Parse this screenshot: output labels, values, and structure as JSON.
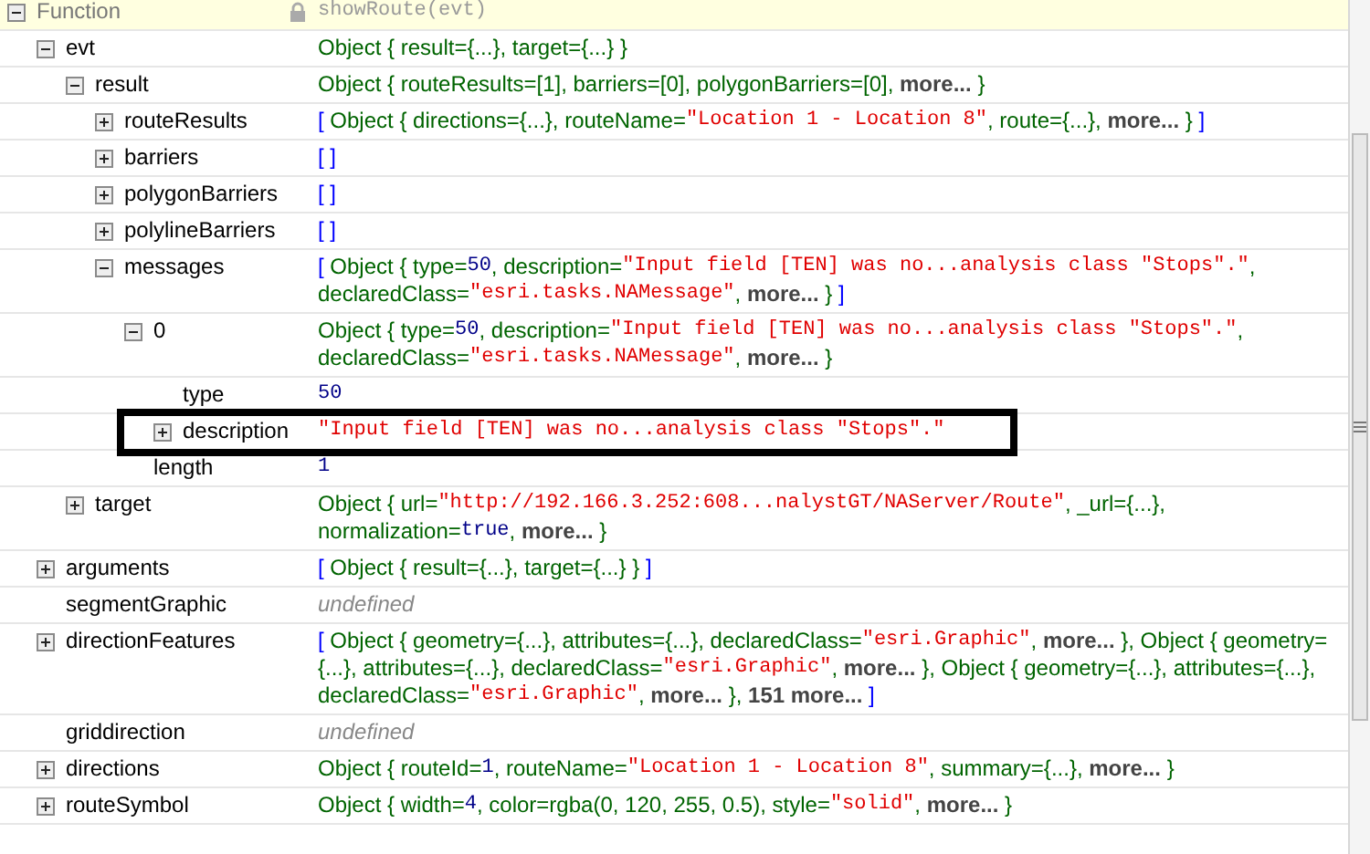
{
  "function": {
    "name": "Function",
    "expanded": true,
    "value": [
      {
        "kind": "code",
        "text": "showRoute(evt)"
      }
    ],
    "children": [
      {
        "name": "evt",
        "expanded": true,
        "value": [
          {
            "kind": "object",
            "text": "Object { result={...}, target={...} }"
          }
        ],
        "children": [
          {
            "name": "result",
            "expanded": true,
            "value": [
              {
                "kind": "object",
                "text": "Object { routeResults=[1], barriers=[0], polygonBarriers=[0], "
              },
              {
                "kind": "more",
                "text": "more..."
              },
              {
                "kind": "object",
                "text": " }"
              }
            ],
            "children": [
              {
                "name": "routeResults",
                "expanded": false,
                "value": [
                  {
                    "kind": "bracket",
                    "text": "[ "
                  },
                  {
                    "kind": "object",
                    "text": "Object { directions={...}, routeName="
                  },
                  {
                    "kind": "string",
                    "text": "\"Location 1 - Location 8\""
                  },
                  {
                    "kind": "object",
                    "text": ", route={...}, "
                  },
                  {
                    "kind": "more",
                    "text": "more..."
                  },
                  {
                    "kind": "object",
                    "text": " }"
                  },
                  {
                    "kind": "bracket",
                    "text": " ]"
                  }
                ]
              },
              {
                "name": "barriers",
                "expanded": false,
                "value": [
                  {
                    "kind": "bracket",
                    "text": "[ ]"
                  }
                ]
              },
              {
                "name": "polygonBarriers",
                "expanded": false,
                "value": [
                  {
                    "kind": "bracket",
                    "text": "[ ]"
                  }
                ]
              },
              {
                "name": "polylineBarriers",
                "expanded": false,
                "value": [
                  {
                    "kind": "bracket",
                    "text": "[ ]"
                  }
                ]
              },
              {
                "name": "messages",
                "expanded": true,
                "value": [
                  {
                    "kind": "bracket",
                    "text": "[ "
                  },
                  {
                    "kind": "object",
                    "text": "Object { type="
                  },
                  {
                    "kind": "number",
                    "text": "50"
                  },
                  {
                    "kind": "object",
                    "text": ", description="
                  },
                  {
                    "kind": "string",
                    "text": "\"Input field [TEN] was no...analysis class \"Stops\".\""
                  },
                  {
                    "kind": "object",
                    "text": ", declaredClass="
                  },
                  {
                    "kind": "string",
                    "text": "\"esri.tasks.NAMessage\""
                  },
                  {
                    "kind": "object",
                    "text": ", "
                  },
                  {
                    "kind": "more",
                    "text": "more..."
                  },
                  {
                    "kind": "object",
                    "text": " }"
                  },
                  {
                    "kind": "bracket",
                    "text": " ]"
                  }
                ],
                "children": [
                  {
                    "name": "0",
                    "expanded": true,
                    "value": [
                      {
                        "kind": "object",
                        "text": "Object { type="
                      },
                      {
                        "kind": "number",
                        "text": "50"
                      },
                      {
                        "kind": "object",
                        "text": ", description="
                      },
                      {
                        "kind": "string",
                        "text": "\"Input field [TEN] was no...analysis class \"Stops\".\""
                      },
                      {
                        "kind": "object",
                        "text": ", declaredClass="
                      },
                      {
                        "kind": "string",
                        "text": "\"esri.tasks.NAMessage\""
                      },
                      {
                        "kind": "object",
                        "text": ", "
                      },
                      {
                        "kind": "more",
                        "text": "more..."
                      },
                      {
                        "kind": "object",
                        "text": " }"
                      }
                    ],
                    "children": [
                      {
                        "name": "type",
                        "value": [
                          {
                            "kind": "number",
                            "text": "50"
                          }
                        ]
                      },
                      {
                        "name": "description",
                        "expanded": false,
                        "highlighted": true,
                        "value": [
                          {
                            "kind": "string",
                            "text": "\"Input field [TEN] was no...analysis class \"Stops\".\""
                          }
                        ]
                      }
                    ]
                  },
                  {
                    "name": "length",
                    "value": [
                      {
                        "kind": "number",
                        "text": "1"
                      }
                    ]
                  }
                ]
              }
            ]
          },
          {
            "name": "target",
            "expanded": false,
            "value": [
              {
                "kind": "object",
                "text": "Object { url="
              },
              {
                "kind": "string",
                "text": "\"http://192.166.3.252:608...nalystGT/NAServer/Route\""
              },
              {
                "kind": "object",
                "text": ", _url={...}, normalization="
              },
              {
                "kind": "number",
                "text": "true"
              },
              {
                "kind": "object",
                "text": ", "
              },
              {
                "kind": "more",
                "text": "more..."
              },
              {
                "kind": "object",
                "text": " }"
              }
            ]
          }
        ]
      },
      {
        "name": "arguments",
        "expanded": false,
        "value": [
          {
            "kind": "bracket",
            "text": "[ "
          },
          {
            "kind": "object",
            "text": "Object { result={...}, target={...} }"
          },
          {
            "kind": "bracket",
            "text": " ]"
          }
        ]
      },
      {
        "name": "segmentGraphic",
        "value": [
          {
            "kind": "undefined",
            "text": "undefined"
          }
        ]
      },
      {
        "name": "directionFeatures",
        "expanded": false,
        "value": [
          {
            "kind": "bracket",
            "text": "[ "
          },
          {
            "kind": "object",
            "text": "Object { geometry={...}, attributes={...}, declaredClass="
          },
          {
            "kind": "string",
            "text": "\"esri.Graphic\""
          },
          {
            "kind": "object",
            "text": ", "
          },
          {
            "kind": "more",
            "text": "more..."
          },
          {
            "kind": "object",
            "text": " }, Object { geometry={...}, attributes={...}, declaredClass="
          },
          {
            "kind": "string",
            "text": "\"esri.Graphic\""
          },
          {
            "kind": "object",
            "text": ", "
          },
          {
            "kind": "more",
            "text": "more..."
          },
          {
            "kind": "object",
            "text": " }, Object { geometry={...}, attributes={...}, declaredClass="
          },
          {
            "kind": "string",
            "text": "\"esri.Graphic\""
          },
          {
            "kind": "object",
            "text": ", "
          },
          {
            "kind": "more",
            "text": "more..."
          },
          {
            "kind": "object",
            "text": " }, "
          },
          {
            "kind": "more",
            "text": "151 more..."
          },
          {
            "kind": "bracket",
            "text": " ]"
          }
        ]
      },
      {
        "name": "griddirection",
        "value": [
          {
            "kind": "undefined",
            "text": "undefined"
          }
        ]
      },
      {
        "name": "directions",
        "expanded": false,
        "value": [
          {
            "kind": "object",
            "text": "Object { routeId="
          },
          {
            "kind": "number",
            "text": "1"
          },
          {
            "kind": "object",
            "text": ", routeName="
          },
          {
            "kind": "string",
            "text": "\"Location 1 - Location 8\""
          },
          {
            "kind": "object",
            "text": ", summary={...}, "
          },
          {
            "kind": "more",
            "text": "more..."
          },
          {
            "kind": "object",
            "text": " }"
          }
        ]
      },
      {
        "name": "routeSymbol",
        "expanded": false,
        "value": [
          {
            "kind": "object",
            "text": "Object { width="
          },
          {
            "kind": "number",
            "text": "4"
          },
          {
            "kind": "object",
            "text": ", color=rgba(0, 120, 255, 0.5), style="
          },
          {
            "kind": "string",
            "text": "\"solid\""
          },
          {
            "kind": "object",
            "text": ", "
          },
          {
            "kind": "more",
            "text": "more..."
          },
          {
            "kind": "object",
            "text": " }"
          }
        ]
      }
    ]
  }
}
